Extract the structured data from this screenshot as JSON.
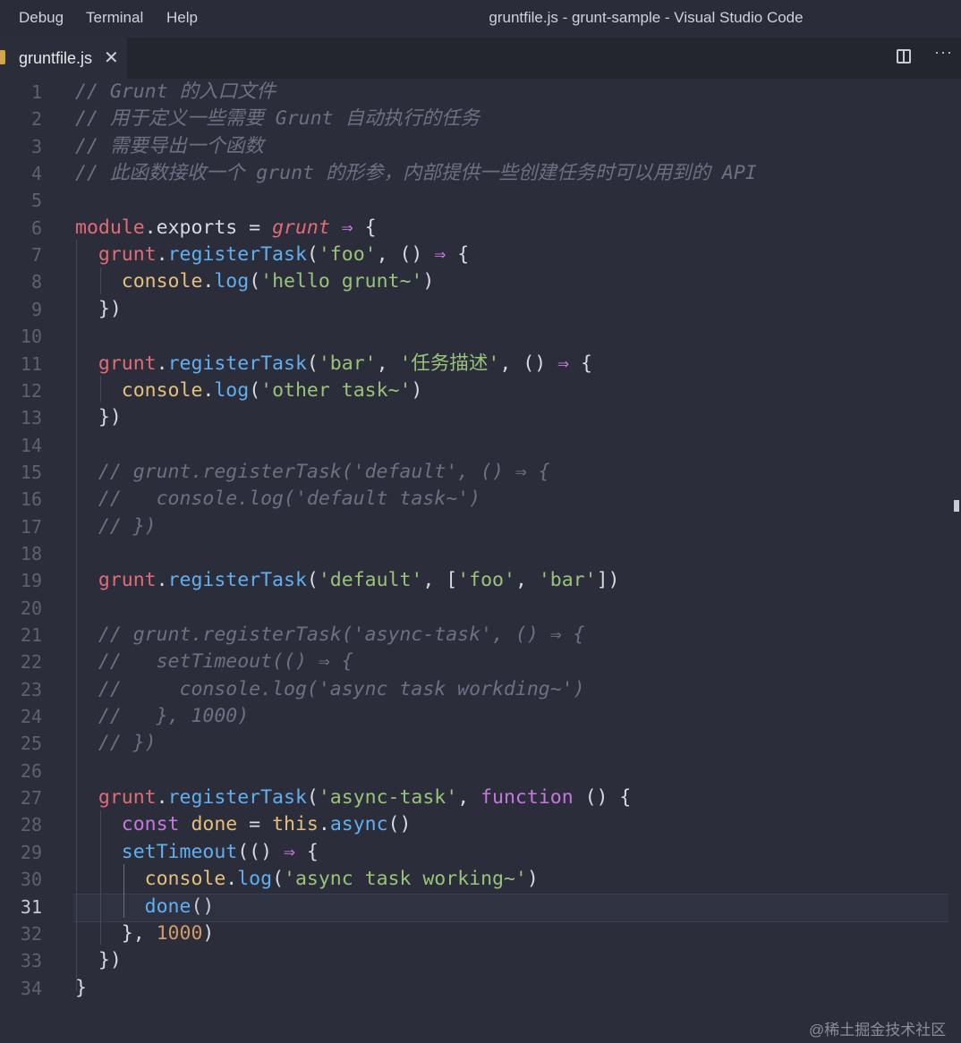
{
  "menu": [
    "Debug",
    "Terminal",
    "Help"
  ],
  "window_title": "gruntfile.js - grunt-sample - Visual Studio Code",
  "tab": {
    "filename": "gruntfile.js",
    "close_symbol": "✕"
  },
  "actions": {
    "more_symbol": "···"
  },
  "active_line": 31,
  "lines": [
    [
      [
        "// Grunt 的入口文件",
        "com"
      ]
    ],
    [
      [
        "// 用于定义一些需要 Grunt 自动执行的任务",
        "com"
      ]
    ],
    [
      [
        "// 需要导出一个函数",
        "com"
      ]
    ],
    [
      [
        "// 此函数接收一个 grunt 的形参，内部提供一些创建任务时可以用到的 API",
        "com"
      ]
    ],
    [],
    [
      [
        "module",
        "var"
      ],
      [
        ".",
        "prop"
      ],
      [
        "exports",
        "prop"
      ],
      [
        " = ",
        "prop"
      ],
      [
        "grunt",
        "param"
      ],
      [
        " ⇒ ",
        "op"
      ],
      [
        "{",
        "prop"
      ]
    ],
    [
      [
        "  grunt",
        "var"
      ],
      [
        ".",
        "prop"
      ],
      [
        "registerTask",
        "fn"
      ],
      [
        "(",
        "prop"
      ],
      [
        "'foo'",
        "str"
      ],
      [
        ", () ",
        "prop"
      ],
      [
        "⇒",
        "op"
      ],
      [
        " {",
        "prop"
      ]
    ],
    [
      [
        "    console",
        "obj"
      ],
      [
        ".",
        "prop"
      ],
      [
        "log",
        "fn"
      ],
      [
        "(",
        "prop"
      ],
      [
        "'hello grunt~'",
        "str"
      ],
      [
        ")",
        "prop"
      ]
    ],
    [
      [
        "  })",
        "prop"
      ]
    ],
    [],
    [
      [
        "  grunt",
        "var"
      ],
      [
        ".",
        "prop"
      ],
      [
        "registerTask",
        "fn"
      ],
      [
        "(",
        "prop"
      ],
      [
        "'bar'",
        "str"
      ],
      [
        ", ",
        "prop"
      ],
      [
        "'任务描述'",
        "str"
      ],
      [
        ", () ",
        "prop"
      ],
      [
        "⇒",
        "op"
      ],
      [
        " {",
        "prop"
      ]
    ],
    [
      [
        "    console",
        "obj"
      ],
      [
        ".",
        "prop"
      ],
      [
        "log",
        "fn"
      ],
      [
        "(",
        "prop"
      ],
      [
        "'other task~'",
        "str"
      ],
      [
        ")",
        "prop"
      ]
    ],
    [
      [
        "  })",
        "prop"
      ]
    ],
    [],
    [
      [
        "  // grunt.registerTask('default', () ⇒ {",
        "com"
      ]
    ],
    [
      [
        "  //   console.log('default task~')",
        "com"
      ]
    ],
    [
      [
        "  // })",
        "com"
      ]
    ],
    [],
    [
      [
        "  grunt",
        "var"
      ],
      [
        ".",
        "prop"
      ],
      [
        "registerTask",
        "fn"
      ],
      [
        "(",
        "prop"
      ],
      [
        "'default'",
        "str"
      ],
      [
        ", [",
        "prop"
      ],
      [
        "'foo'",
        "str"
      ],
      [
        ", ",
        "prop"
      ],
      [
        "'bar'",
        "str"
      ],
      [
        "])",
        "prop"
      ]
    ],
    [],
    [
      [
        "  // grunt.registerTask('async-task', () ⇒ {",
        "com"
      ]
    ],
    [
      [
        "  //   setTimeout(() ⇒ {",
        "com"
      ]
    ],
    [
      [
        "  //     console.log('async task workding~')",
        "com"
      ]
    ],
    [
      [
        "  //   }, 1000)",
        "com"
      ]
    ],
    [
      [
        "  // })",
        "com"
      ]
    ],
    [],
    [
      [
        "  grunt",
        "var"
      ],
      [
        ".",
        "prop"
      ],
      [
        "registerTask",
        "fn"
      ],
      [
        "(",
        "prop"
      ],
      [
        "'async-task'",
        "str"
      ],
      [
        ", ",
        "prop"
      ],
      [
        "function",
        "kw"
      ],
      [
        " () {",
        "prop"
      ]
    ],
    [
      [
        "    const",
        "kw"
      ],
      [
        " done",
        "obj"
      ],
      [
        " = ",
        "prop"
      ],
      [
        "this",
        "obj"
      ],
      [
        ".",
        "prop"
      ],
      [
        "async",
        "fn"
      ],
      [
        "()",
        "prop"
      ]
    ],
    [
      [
        "    setTimeout",
        "fn"
      ],
      [
        "(() ",
        "prop"
      ],
      [
        "⇒",
        "op"
      ],
      [
        " {",
        "prop"
      ]
    ],
    [
      [
        "      console",
        "obj"
      ],
      [
        ".",
        "prop"
      ],
      [
        "log",
        "fn"
      ],
      [
        "(",
        "prop"
      ],
      [
        "'async task working~'",
        "str"
      ],
      [
        ")",
        "prop"
      ]
    ],
    [
      [
        "      done",
        "done"
      ],
      [
        "()",
        "dim"
      ]
    ],
    [
      [
        "    }, ",
        "prop"
      ],
      [
        "1000",
        "num"
      ],
      [
        ")",
        "prop"
      ]
    ],
    [
      [
        "  })",
        "prop"
      ]
    ],
    [
      [
        "}",
        "prop"
      ]
    ]
  ],
  "watermark": "@稀土掘金技术社区"
}
